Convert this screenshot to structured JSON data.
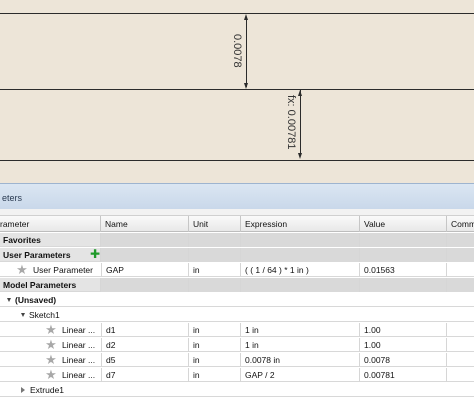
{
  "canvas": {
    "dimension_upper": "0.0078",
    "dimension_lower": "fx: 0.00781"
  },
  "dialog": {
    "title_fragment": "eters"
  },
  "columns": {
    "parameter": "rameter",
    "name": "Name",
    "unit": "Unit",
    "expression": "Expression",
    "value": "Value",
    "comment": "Comm"
  },
  "groups": {
    "favorites": "Favorites",
    "user_parameters": "User Parameters",
    "model_parameters": "Model Parameters",
    "unsaved": "(Unsaved)",
    "sketch1": "Sketch1",
    "extrude1": "Extrude1"
  },
  "icons": {
    "add": "plus-icon",
    "favorite": "star-icon"
  },
  "colors": {
    "canvas": "#ede5d8",
    "add_icon": "#1f9a2a",
    "title_bar": "#c9d8ea"
  },
  "rows": [
    {
      "parameter": "User Parameter",
      "name": "GAP",
      "unit": "in",
      "expression": "( ( 1 / 64 ) * 1 in )",
      "value": "0.01563"
    },
    {
      "parameter": "Linear ...",
      "name": "d1",
      "unit": "in",
      "expression": "1 in",
      "value": "1.00"
    },
    {
      "parameter": "Linear ...",
      "name": "d2",
      "unit": "in",
      "expression": "1 in",
      "value": "1.00"
    },
    {
      "parameter": "Linear ...",
      "name": "d5",
      "unit": "in",
      "expression": "0.0078 in",
      "value": "0.0078"
    },
    {
      "parameter": "Linear ...",
      "name": "d7",
      "unit": "in",
      "expression": "GAP / 2",
      "value": "0.00781"
    }
  ]
}
